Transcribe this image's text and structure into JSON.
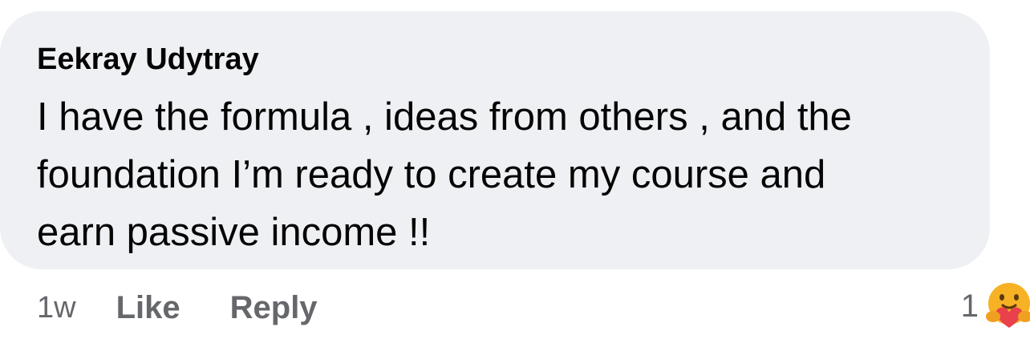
{
  "comment": {
    "author": "Eekray Udytray",
    "text_lines": [
      "I have the formula , ideas from others , and the",
      "foundation I’m ready to create my course and",
      "earn passive income !!"
    ]
  },
  "actions": {
    "timestamp": "1w",
    "like_label": "Like",
    "reply_label": "Reply"
  },
  "reactions": {
    "count": "1",
    "icon": "care-reaction-icon",
    "colors": {
      "face": "#f7b125",
      "heart": "#e9414b"
    }
  },
  "colors": {
    "bubble_background": "#eff0f3",
    "primary_text": "#050505",
    "secondary_text": "#65676b"
  }
}
